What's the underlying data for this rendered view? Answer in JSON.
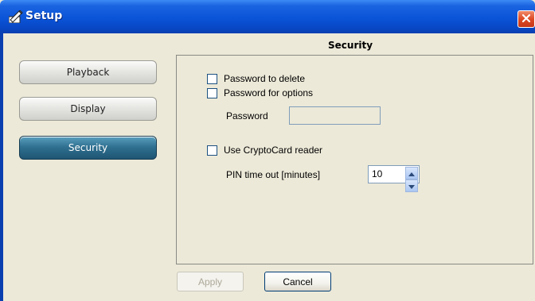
{
  "window": {
    "title": "Setup",
    "icons": {
      "app": "setup-pen-icon",
      "close": "close-icon"
    },
    "colors": {
      "titlebar": "#0a54d8",
      "close": "#de4a24",
      "active_tab": "#2f6f8f"
    }
  },
  "sidebar": {
    "items": [
      {
        "label": "Playback",
        "active": false
      },
      {
        "label": "Display",
        "active": false
      },
      {
        "label": "Security",
        "active": true
      }
    ]
  },
  "section": {
    "title": "Security",
    "password_to_delete": {
      "label": "Password to delete",
      "checked": false
    },
    "password_for_options": {
      "label": "Password for options",
      "checked": false
    },
    "password_label": "Password",
    "password_value": "",
    "use_cryptocard": {
      "label": "Use CryptoCard reader",
      "checked": false
    },
    "pin_timeout_label": "PIN time out [minutes]",
    "pin_timeout_value": "10"
  },
  "footer": {
    "apply_label": "Apply",
    "cancel_label": "Cancel"
  }
}
